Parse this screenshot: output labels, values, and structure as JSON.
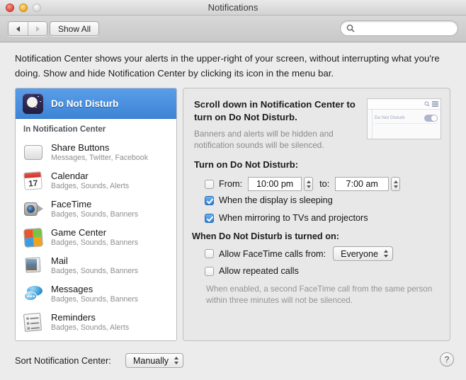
{
  "window": {
    "title": "Notifications",
    "traffic": {
      "close": "close-button",
      "minimize": "minimize-button",
      "zoom": "zoom-button"
    }
  },
  "toolbar": {
    "back_label": "back",
    "forward_label": "forward",
    "show_all_label": "Show All",
    "search_placeholder": "",
    "search_value": ""
  },
  "description": "Notification Center shows your alerts in the upper-right of your screen, without interrupting what you're doing. Show and hide Notification Center by clicking its icon in the menu bar.",
  "sidebar": {
    "selected": {
      "label": "Do Not Disturb",
      "icon": "moon-icon"
    },
    "section_header": "In Notification Center",
    "items": [
      {
        "name": "Share Buttons",
        "sub": "Messages, Twitter, Facebook",
        "icon": "share-icon"
      },
      {
        "name": "Calendar",
        "sub": "Badges, Sounds, Alerts",
        "icon": "calendar-icon",
        "day": "17"
      },
      {
        "name": "FaceTime",
        "sub": "Badges, Sounds, Banners",
        "icon": "facetime-icon"
      },
      {
        "name": "Game Center",
        "sub": "Badges, Sounds, Banners",
        "icon": "game-center-icon"
      },
      {
        "name": "Mail",
        "sub": "Badges, Sounds, Banners",
        "icon": "mail-icon"
      },
      {
        "name": "Messages",
        "sub": "Badges, Sounds, Banners",
        "icon": "messages-icon"
      },
      {
        "name": "Reminders",
        "sub": "Badges, Sounds, Alerts",
        "icon": "reminders-icon"
      }
    ]
  },
  "panel": {
    "title": "Scroll down in Notification Center to turn on Do Not Disturb.",
    "subtitle": "Banners and alerts will be hidden and notification sounds will be silenced.",
    "thumbnail": {
      "label": "Do Not Disturb",
      "toggle_state": "on"
    },
    "turn_on_header": "Turn on Do Not Disturb:",
    "schedule": {
      "checked": false,
      "from_label": "From:",
      "from_value": "10:00 pm",
      "to_label": "to:",
      "to_value": "7:00 am"
    },
    "display_sleeping": {
      "checked": true,
      "label": "When the display is sleeping"
    },
    "mirroring": {
      "checked": true,
      "label": "When mirroring to TVs and projectors"
    },
    "when_on_header": "When Do Not Disturb is turned on:",
    "facetime_calls": {
      "checked": false,
      "label": "Allow FaceTime calls from:",
      "selected_option": "Everyone"
    },
    "repeated_calls": {
      "checked": false,
      "label": "Allow repeated calls"
    },
    "note": "When enabled, a second FaceTime call from the same person within three minutes will not be silenced."
  },
  "bottom": {
    "sort_label": "Sort Notification Center:",
    "sort_value": "Manually",
    "help_label": "?"
  },
  "colors": {
    "selection_blue": "#3d84d6",
    "checkbox_blue": "#2d7fd6",
    "window_bg": "#ececec",
    "panel_bg": "#e8e8e8"
  }
}
